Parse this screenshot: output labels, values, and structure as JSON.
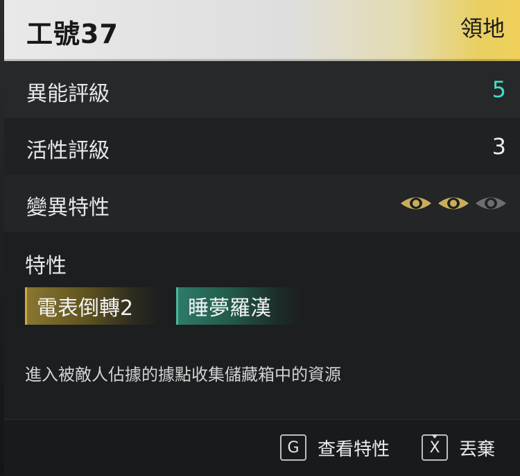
{
  "header": {
    "title": "工號37",
    "tag": "領地"
  },
  "stats": {
    "ability_rating": {
      "label": "異能評級",
      "value": "5",
      "value_color": "#3fe0c6"
    },
    "activity_rating": {
      "label": "活性評級",
      "value": "3"
    },
    "mutation": {
      "label": "變異特性",
      "icons": [
        "eye-icon",
        "eye-icon",
        "eye-icon"
      ],
      "active_count": 2,
      "total_count": 3,
      "active_color": "#c9ae5a",
      "inactive_color": "#6e6e6e"
    }
  },
  "traits": {
    "title": "特性",
    "items": [
      {
        "label": "電表倒轉2",
        "color": "#c9aa48"
      },
      {
        "label": "睡夢羅漢",
        "color": "#48b89a"
      }
    ],
    "description": "進入被敵人佔據的據點收集儲藏箱中的資源"
  },
  "footer": {
    "view_traits": {
      "key": "G",
      "label": "查看特性"
    },
    "discard": {
      "key": "X",
      "label": "丟棄"
    }
  }
}
